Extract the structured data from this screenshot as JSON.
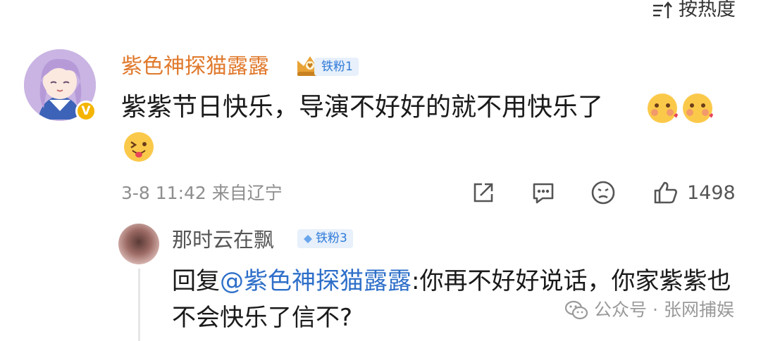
{
  "sort": {
    "label": "按热度"
  },
  "comment": {
    "username": "紫色神探猫露露",
    "fan_badge": "铁粉1",
    "verified_mark": "V",
    "text": "紫紫节日快乐，导演不好好的就不用快乐了",
    "timestamp": "3-8 11:42",
    "location": "来自辽宁",
    "likes": "1498",
    "icons": [
      "share-icon",
      "comment-icon",
      "dislike-icon",
      "like-icon"
    ]
  },
  "reply": {
    "username": "那时云在飘",
    "fan_badge": "铁粉3",
    "prefix": "回复",
    "mention": "@紫色神探猫露露",
    "text": ":你再不好好说话，你家紫紫也不会快乐了信不?"
  },
  "watermark": {
    "source": "公众号",
    "separator": "·",
    "author": "张网捕娱"
  },
  "colors": {
    "username_orange": "#e0792c",
    "mention_blue": "#2e6fc9",
    "badge_blue": "#2f7ad8",
    "meta_gray": "#8e8e8e"
  }
}
